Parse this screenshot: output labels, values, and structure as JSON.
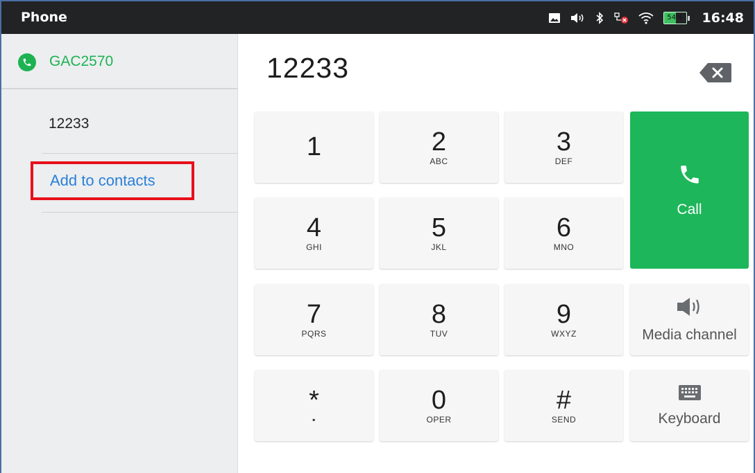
{
  "statusbar": {
    "title": "Phone",
    "battery": "54%",
    "battery_level": 0.54,
    "time": "16:48",
    "icons": [
      "image-icon",
      "volume-icon",
      "bluetooth-icon",
      "network-error-icon",
      "wifi-icon",
      "battery-icon"
    ]
  },
  "sidebar": {
    "account_name": "GAC2570",
    "entries": [
      {
        "label": "12233"
      },
      {
        "label": "Add to contacts"
      }
    ]
  },
  "dialer": {
    "number": "12233",
    "keys": [
      {
        "digit": "1",
        "letters": ""
      },
      {
        "digit": "2",
        "letters": "ABC"
      },
      {
        "digit": "3",
        "letters": "DEF"
      },
      {
        "digit": "4",
        "letters": "GHI"
      },
      {
        "digit": "5",
        "letters": "JKL"
      },
      {
        "digit": "6",
        "letters": "MNO"
      },
      {
        "digit": "7",
        "letters": "PQRS"
      },
      {
        "digit": "8",
        "letters": "TUV"
      },
      {
        "digit": "9",
        "letters": "WXYZ"
      },
      {
        "digit": "*",
        "letters": ""
      },
      {
        "digit": "0",
        "letters": "OPER"
      },
      {
        "digit": "#",
        "letters": "SEND"
      }
    ],
    "call_label": "Call",
    "media_label": "Media channel",
    "keyboard_label": "Keyboard"
  },
  "colors": {
    "accent_green": "#1db65a",
    "link_blue": "#2a7fd8",
    "highlight_red": "#e8101a"
  }
}
